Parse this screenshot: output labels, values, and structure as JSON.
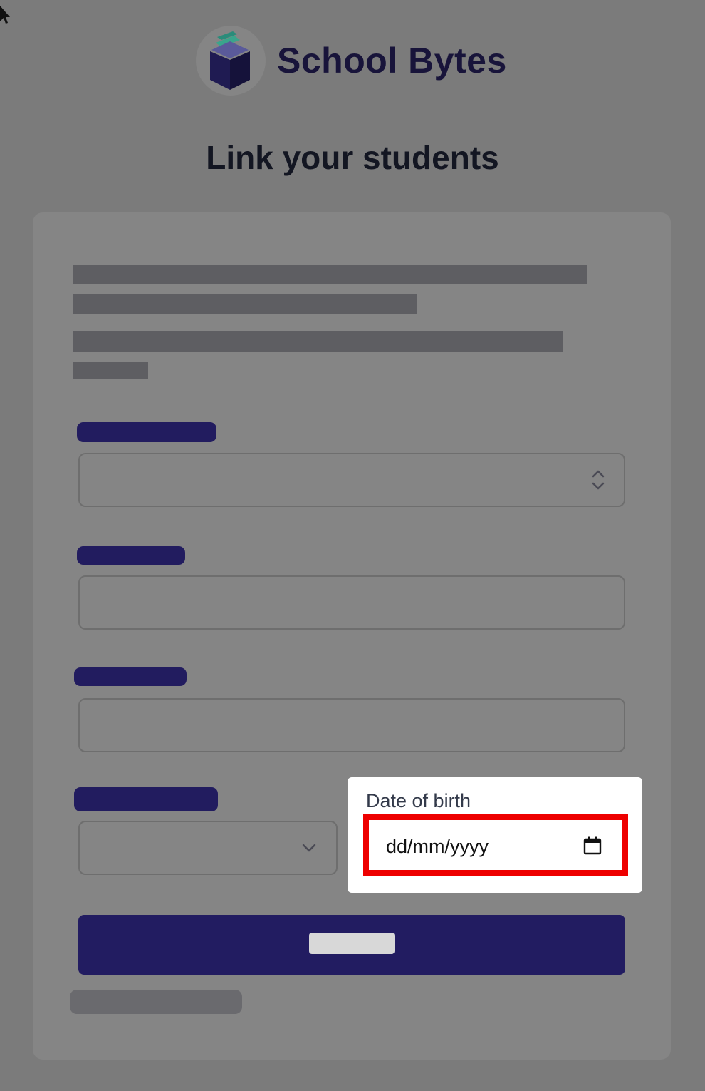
{
  "app": {
    "brand_name": "School Bytes",
    "brand_icon": "school-bytes-book-icon"
  },
  "page": {
    "title": "Link your students"
  },
  "form": {
    "school_select": {
      "icon": "up-down-chevron-icon"
    },
    "year_select": {
      "icon": "chevron-down-icon"
    },
    "date_of_birth": {
      "label": "Date of birth",
      "value": "dd/mm/yyyy",
      "icon": "calendar-icon"
    }
  },
  "colors": {
    "brand": "#221c61",
    "highlight": "#ee0000",
    "overlay": "#7b7b7b"
  }
}
